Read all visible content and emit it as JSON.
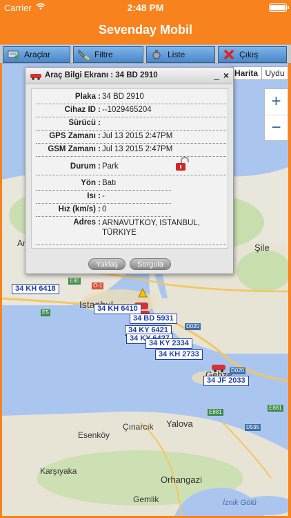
{
  "statusbar": {
    "carrier": "Carrier",
    "time": "2:48 PM"
  },
  "app": {
    "title": "Sevenday Mobil"
  },
  "toolbar": {
    "vehicles": "Araçlar",
    "filter": "Filtre",
    "list": "Liste",
    "logout": "Çıkış"
  },
  "map": {
    "type_map": "Harita",
    "type_satellite": "Uydu",
    "zoom_in": "+",
    "zoom_out": "−",
    "place_labels": [
      "Araçlar",
      "Şile",
      "Istanbul",
      "Gebze",
      "Çınarcık",
      "Yalova",
      "Esenköy",
      "Karşıyaka",
      "Orhangazi",
      "Gemlik",
      "İznik Gölü"
    ],
    "road_labels": [
      "E80",
      "O-1",
      "E5",
      "D020",
      "E881",
      "E881",
      "D595",
      "D020"
    ],
    "plates": [
      "34 KH 6418",
      "34 KH 6410",
      "34 BD 5931",
      "34 KY 6427",
      "34 KY 2334",
      "34 KH 2733",
      "34 JF 2033",
      "34 KY 6421"
    ]
  },
  "panel": {
    "title": "Araç Bilgi Ekranı : 34 BD 2910",
    "minimize": "_",
    "close": "×",
    "rows": [
      {
        "label": "Plaka :",
        "value": "34 BD 2910"
      },
      {
        "label": "Cihaz ID :",
        "value": "--1029465204"
      },
      {
        "label": "Sürücü :",
        "value": ""
      },
      {
        "label": "GPS Zamanı :",
        "value": "Jul 13 2015 2:47PM"
      },
      {
        "label": "GSM Zamanı :",
        "value": "Jul 13 2015 2:47PM"
      },
      {
        "label": "Durum :",
        "value": "Park"
      },
      {
        "label": "Yön :",
        "value": "Batı"
      },
      {
        "label": "Isı :",
        "value": "-"
      },
      {
        "label": "Hız (km/s) :",
        "value": "0"
      },
      {
        "label": "Adres :",
        "value": "ARNAVUTKOY, ISTANBUL, TÜRKIYE"
      }
    ],
    "approach_button": "Yaklaş",
    "query_button": "Sorgula"
  },
  "colors": {
    "brand": "#f7821e",
    "toolbar_button": "#5b95d4",
    "plate_border": "#1f3fa8",
    "sea": "#aac6ef"
  }
}
